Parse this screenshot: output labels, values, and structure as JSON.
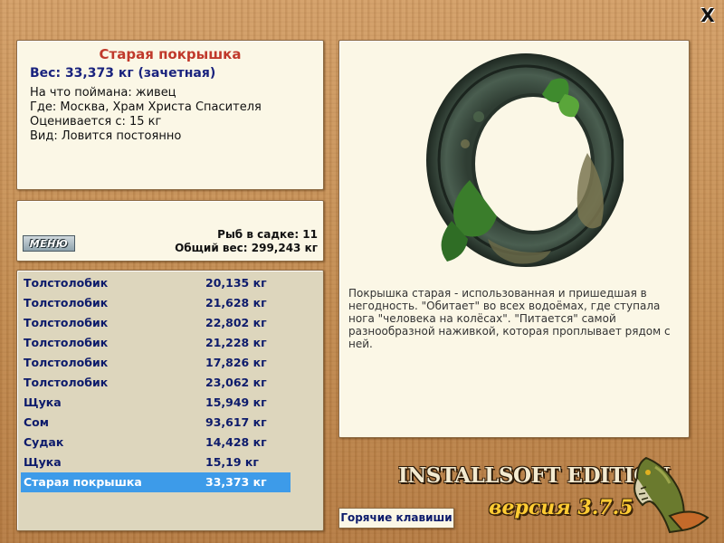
{
  "close_label": "X",
  "fish": {
    "name": "Старая покрышка",
    "weight_line": "Вес: 33,373 кг (зачетная)",
    "caught_on": "На что поймана: живец",
    "where": "Где: Москва, Храм Христа Спасителя",
    "valued_from": "Оценивается с: 15 кг",
    "kind": "Вид: Ловится постоянно"
  },
  "summary": {
    "menu_label": "МЕНЮ",
    "fish_in_keepnet": "Рыб в садке: 11",
    "total_weight": "Общий вес: 299,243 кг"
  },
  "catch_list": [
    {
      "name": "Толстолобик",
      "weight": "20,135 кг"
    },
    {
      "name": "Толстолобик",
      "weight": "21,628 кг"
    },
    {
      "name": "Толстолобик",
      "weight": "22,802 кг"
    },
    {
      "name": "Толстолобик",
      "weight": "21,228 кг"
    },
    {
      "name": "Толстолобик",
      "weight": "17,826 кг"
    },
    {
      "name": "Толстолобик",
      "weight": "23,062 кг"
    },
    {
      "name": "Щука",
      "weight": "15,949 кг"
    },
    {
      "name": "Сом",
      "weight": "93,617 кг"
    },
    {
      "name": "Судак",
      "weight": "14,428 кг"
    },
    {
      "name": "Щука",
      "weight": "15,19 кг"
    },
    {
      "name": "Старая покрышка",
      "weight": "33,373 кг",
      "selected": true
    }
  ],
  "description": "Покрышка старая - использованная и пришедшая в негодность. \"Обитает\" во всех водоёмах, где ступала нога \"человека на колёсах\". \"Питается\" самой разнообразной наживкой, которая проплывает рядом с ней.",
  "footer": {
    "hotkeys_label": "Горячие клавиши",
    "edition": "INSTALLSOFT EDITION",
    "version": "версия 3.7.5"
  },
  "icons": {
    "close": "close-icon",
    "tire": "tire-image",
    "pike": "pike-logo"
  },
  "colors": {
    "title_red": "#c0392b",
    "text_navy": "#0d1b6b",
    "selection_blue": "#3d9be9",
    "panel_bg": "#fbf7e6",
    "wood": "#c9955c"
  }
}
